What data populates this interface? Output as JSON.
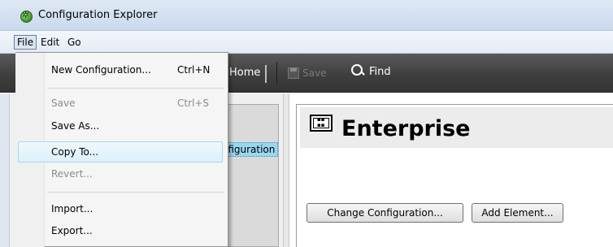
{
  "window": {
    "title": "Configuration Explorer"
  },
  "menubar": {
    "file": "File",
    "edit": "Edit",
    "go": "Go"
  },
  "toolbar": {
    "home": "Home",
    "save": "Save",
    "find": "Find"
  },
  "tree": {
    "selected_item": "Configuration"
  },
  "content": {
    "title": "Enterprise",
    "change_button": "Change Configuration...",
    "add_button": "Add Element..."
  },
  "file_menu": {
    "items": [
      {
        "label": "New Configuration...",
        "shortcut": "Ctrl+N",
        "enabled": true
      },
      {
        "label": "Save",
        "shortcut": "Ctrl+S",
        "enabled": false
      },
      {
        "label": "Save As...",
        "shortcut": "",
        "enabled": true
      },
      {
        "label": "Copy To...",
        "shortcut": "",
        "enabled": true,
        "highlighted": true
      },
      {
        "label": "Revert...",
        "shortcut": "",
        "enabled": false
      },
      {
        "label": "Import...",
        "shortcut": "",
        "enabled": true
      },
      {
        "label": "Export...",
        "shortcut": "",
        "enabled": true
      }
    ]
  }
}
